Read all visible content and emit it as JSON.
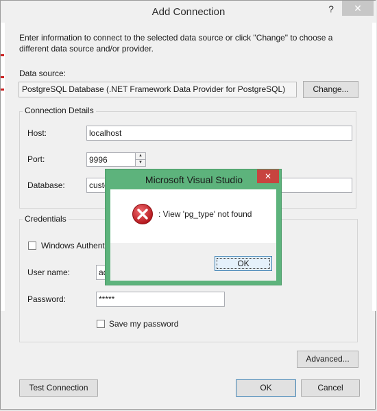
{
  "dialog": {
    "title": "Add Connection",
    "help_symbol": "?",
    "close_symbol": "✕",
    "intro_text": "Enter information to connect to the selected data source or click \"Change\" to choose a different data source and/or provider.",
    "data_source_label": "Data source:",
    "data_source_value": "PostgreSQL Database (.NET Framework Data Provider for PostgreSQL)",
    "change_button": "Change...",
    "connection_details": {
      "title": "Connection Details",
      "host_label": "Host:",
      "host_value": "localhost",
      "port_label": "Port:",
      "port_value": "9996",
      "database_label": "Database:",
      "database_value": "custo"
    },
    "credentials": {
      "title": "Credentials",
      "windows_auth_label": "Windows Authent",
      "username_label": "User name:",
      "username_value": "ad",
      "password_label": "Password:",
      "password_value": "*****",
      "save_password_label": "Save my password"
    },
    "advanced_button": "Advanced...",
    "test_connection_button": "Test Connection",
    "ok_button": "OK",
    "cancel_button": "Cancel"
  },
  "message_box": {
    "title": "Microsoft Visual Studio",
    "close_symbol": "✕",
    "message": ": View 'pg_type' not found",
    "ok_button": "OK",
    "icon": "error-icon"
  },
  "colors": {
    "msgbox_frame": "#5db37c",
    "close_red": "#c8443f",
    "error_red": "#c9252b"
  }
}
